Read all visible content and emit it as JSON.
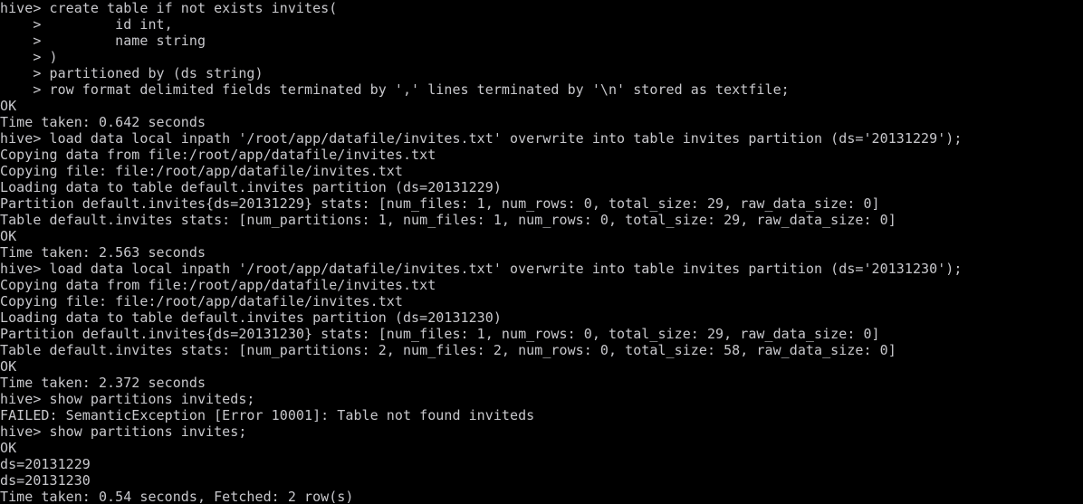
{
  "terminal": {
    "shell_name": "hive",
    "prompt": "hive>",
    "continuation_prompt": ">",
    "background_color": "#000000",
    "foreground_color": "#c8c8cc",
    "columns": 119,
    "rows": 31,
    "lines": [
      "hive> create table if not exists invites(",
      "    >         id int,",
      "    >         name string",
      "    > )",
      "    > partitioned by (ds string)",
      "    > row format delimited fields terminated by ',' lines terminated by '\\n' stored as textfile;",
      "OK",
      "Time taken: 0.642 seconds",
      "hive> load data local inpath '/root/app/datafile/invites.txt' overwrite into table invites partition (ds='20131229');",
      "Copying data from file:/root/app/datafile/invites.txt",
      "Copying file: file:/root/app/datafile/invites.txt",
      "Loading data to table default.invites partition (ds=20131229)",
      "Partition default.invites{ds=20131229} stats: [num_files: 1, num_rows: 0, total_size: 29, raw_data_size: 0]",
      "Table default.invites stats: [num_partitions: 1, num_files: 1, num_rows: 0, total_size: 29, raw_data_size: 0]",
      "OK",
      "Time taken: 2.563 seconds",
      "hive> load data local inpath '/root/app/datafile/invites.txt' overwrite into table invites partition (ds='20131230');",
      "Copying data from file:/root/app/datafile/invites.txt",
      "Copying file: file:/root/app/datafile/invites.txt",
      "Loading data to table default.invites partition (ds=20131230)",
      "Partition default.invites{ds=20131230} stats: [num_files: 1, num_rows: 0, total_size: 29, raw_data_size: 0]",
      "Table default.invites stats: [num_partitions: 2, num_files: 2, num_rows: 0, total_size: 58, raw_data_size: 0]",
      "OK",
      "Time taken: 2.372 seconds",
      "hive> show partitions inviteds;",
      "FAILED: SemanticException [Error 10001]: Table not found inviteds",
      "hive> show partitions invites;",
      "OK",
      "ds=20131229",
      "ds=20131230",
      "Time taken: 0.54 seconds, Fetched: 2 row(s)"
    ]
  }
}
